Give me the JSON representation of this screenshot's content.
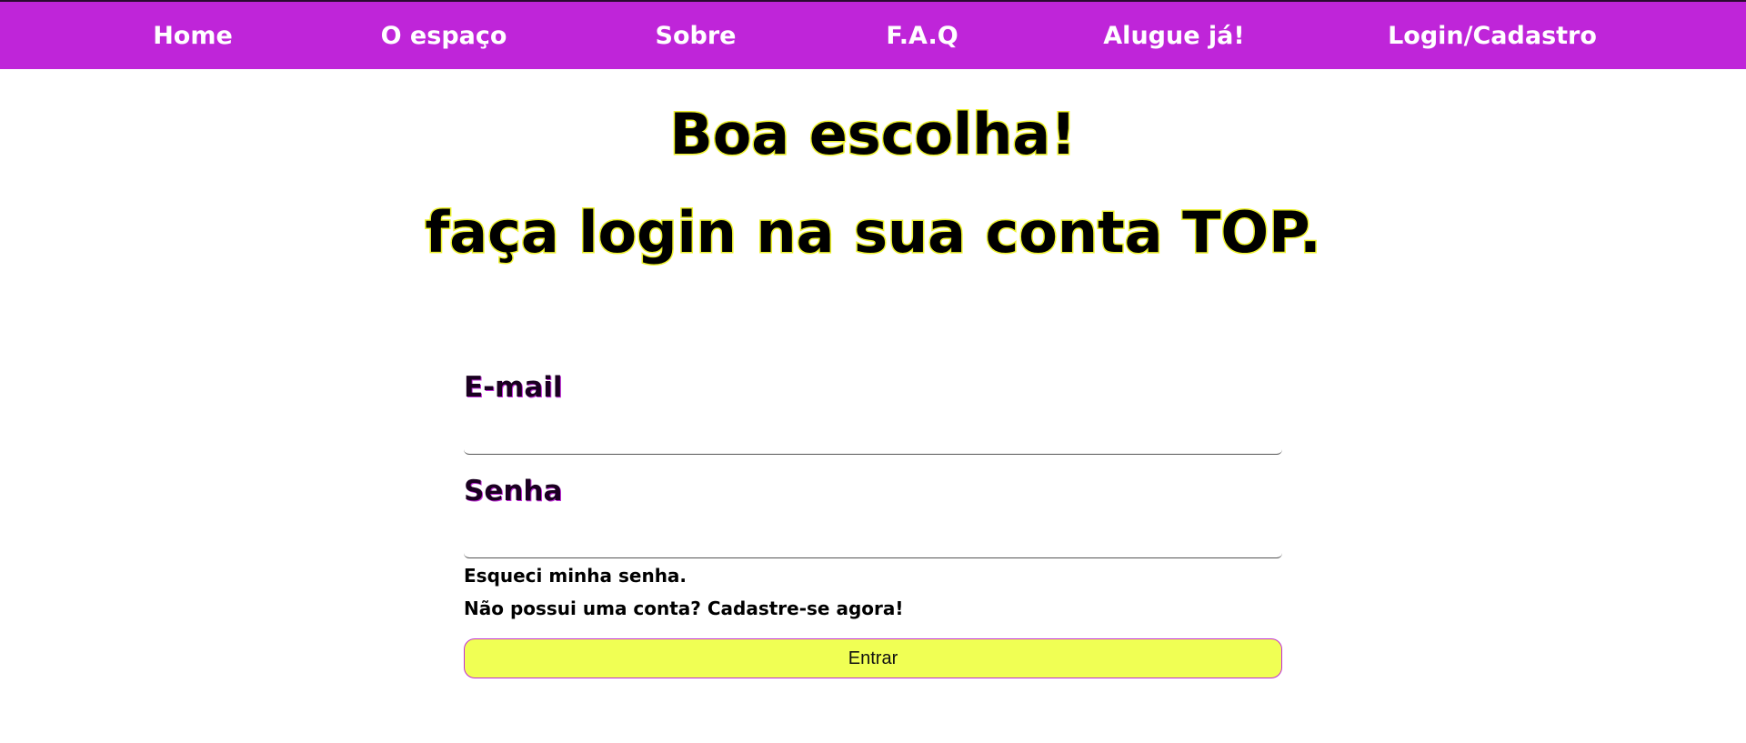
{
  "nav": {
    "items": [
      {
        "label": "Home"
      },
      {
        "label": "O espaço"
      },
      {
        "label": "Sobre"
      },
      {
        "label": "F.A.Q"
      },
      {
        "label": "Alugue já!"
      },
      {
        "label": "Login/Cadastro"
      }
    ]
  },
  "main": {
    "headline_1": "Boa escolha!",
    "headline_2": "faça login na sua conta TOP.",
    "email_label": "E-mail",
    "email_value": "",
    "password_label": "Senha",
    "password_value": "",
    "forgot_password": "Esqueci minha senha.",
    "signup_prompt": "Não possui uma conta? Cadastre-se agora!",
    "submit_label": "Entrar"
  },
  "colors": {
    "nav_background": "#bf25d9",
    "headline_outline": "#eef22c",
    "button_background": "#f0ff54",
    "button_border": "#c02bd8"
  }
}
